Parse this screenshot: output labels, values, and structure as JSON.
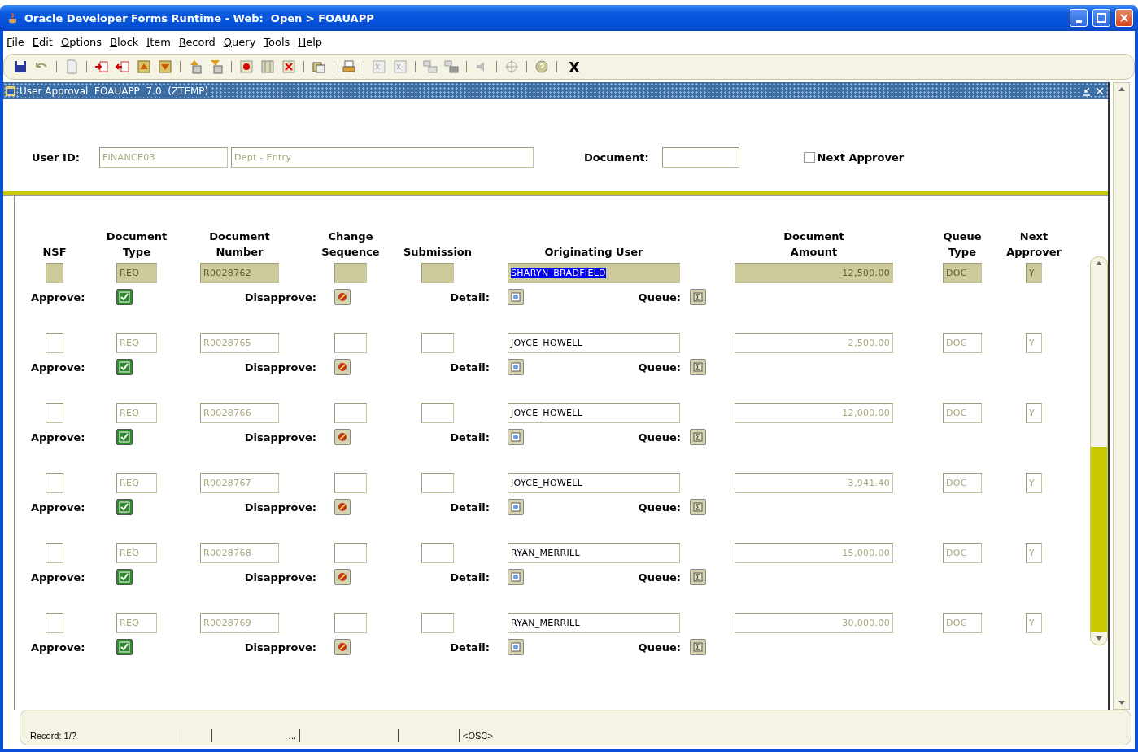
{
  "window": {
    "title": "Oracle Developer Forms Runtime - Web:  Open > FOAUAPP"
  },
  "menu": [
    {
      "label": "File"
    },
    {
      "label": "Edit"
    },
    {
      "label": "Options"
    },
    {
      "label": "Block"
    },
    {
      "label": "Item"
    },
    {
      "label": "Record"
    },
    {
      "label": "Query"
    },
    {
      "label": "Tools"
    },
    {
      "label": "Help"
    }
  ],
  "toolbar": {
    "exit_label": "X"
  },
  "form_window": {
    "title": "User Approval  FOAUAPP  7.0  (ZTEMP)"
  },
  "key_block": {
    "user_id_label": "User ID:",
    "user_id": "FINANCE03",
    "user_name": "Dept - Entry",
    "document_label": "Document:",
    "next_approver": {
      "label": "Next Approver",
      "checked": false
    }
  },
  "columns": [
    {
      "lines": [
        "NSF"
      ]
    },
    {
      "lines": [
        "Document",
        "Type"
      ]
    },
    {
      "lines": [
        "Document",
        "Number"
      ]
    },
    {
      "lines": [
        "Change",
        "Sequence"
      ]
    },
    {
      "lines": [
        "Submission"
      ]
    },
    {
      "lines": [
        "Originating User"
      ]
    },
    {
      "lines": [
        "Document",
        "Amount"
      ]
    },
    {
      "lines": [
        "Queue",
        "Type"
      ]
    },
    {
      "lines": [
        "Next",
        "Approver"
      ]
    }
  ],
  "records": [
    {
      "current": true,
      "document_type": "REQ",
      "document_number": "R0028762",
      "originating_user": "SHARYN_BRADFIELD",
      "user_selected": true,
      "document_amount": "12,500.00",
      "queue_type": "DOC",
      "next_approver": "Y",
      "approve_label": "Approve:",
      "approve": true,
      "disapprove_label": "Disapprove:",
      "detail_label": "Detail:",
      "queue_label": "Queue:"
    },
    {
      "current": false,
      "document_type": "REQ",
      "document_number": "R0028765",
      "originating_user": "JOYCE_HOWELL",
      "user_selected": false,
      "document_amount": "2,500.00",
      "queue_type": "DOC",
      "next_approver": "Y",
      "approve_label": "Approve:",
      "approve": true,
      "disapprove_label": "Disapprove:",
      "detail_label": "Detail:",
      "queue_label": "Queue:"
    },
    {
      "current": false,
      "document_type": "REQ",
      "document_number": "R0028766",
      "originating_user": "JOYCE_HOWELL",
      "user_selected": false,
      "document_amount": "12,000.00",
      "queue_type": "DOC",
      "next_approver": "Y",
      "approve_label": "Approve:",
      "approve": true,
      "disapprove_label": "Disapprove:",
      "detail_label": "Detail:",
      "queue_label": "Queue:"
    },
    {
      "current": false,
      "document_type": "REQ",
      "document_number": "R0028767",
      "originating_user": "JOYCE_HOWELL",
      "user_selected": false,
      "document_amount": "3,941.40",
      "queue_type": "DOC",
      "next_approver": "Y",
      "approve_label": "Approve:",
      "approve": true,
      "disapprove_label": "Disapprove:",
      "detail_label": "Detail:",
      "queue_label": "Queue:"
    },
    {
      "current": false,
      "document_type": "REQ",
      "document_number": "R0028768",
      "originating_user": "RYAN_MERRILL",
      "user_selected": false,
      "document_amount": "15,000.00",
      "queue_type": "DOC",
      "next_approver": "Y",
      "approve_label": "Approve:",
      "approve": true,
      "disapprove_label": "Disapprove:",
      "detail_label": "Detail:",
      "queue_label": "Queue:"
    },
    {
      "current": false,
      "document_type": "REQ",
      "document_number": "R0028769",
      "originating_user": "RYAN_MERRILL",
      "user_selected": false,
      "document_amount": "30,000.00",
      "queue_type": "DOC",
      "next_approver": "Y",
      "approve_label": "Approve:",
      "approve": true,
      "disapprove_label": "Disapprove:",
      "detail_label": "Detail:",
      "queue_label": "Queue:"
    }
  ],
  "status_bar": {
    "record": "Record: 1/?",
    "ellipsis": "...",
    "mode": "<OSC>"
  }
}
